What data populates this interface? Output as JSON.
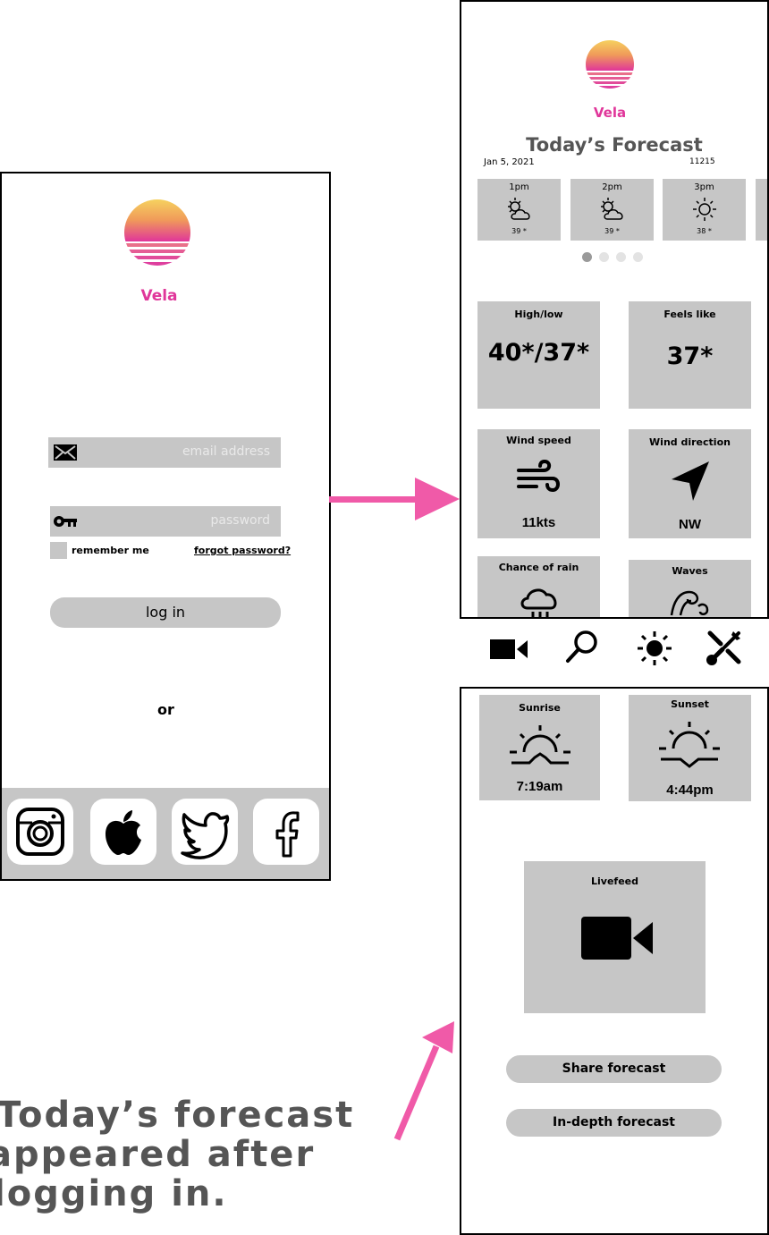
{
  "brand": {
    "name": "Vela",
    "color": "#e0369a"
  },
  "login": {
    "email_placeholder": "email address",
    "password_placeholder": "password",
    "remember_label": "remember me",
    "forgot_label": "forgot password?",
    "login_label": "log in",
    "or_label": "or",
    "social_icons": [
      "instagram-icon",
      "apple-icon",
      "twitter-icon",
      "facebook-icon"
    ]
  },
  "forecast": {
    "title": "Today’s Forecast",
    "date": "Jan 5, 2021",
    "zip": "11215",
    "hours": [
      {
        "time": "1pm",
        "temp": "39 *",
        "icon": "partly-cloudy-icon"
      },
      {
        "time": "2pm",
        "temp": "39 *",
        "icon": "partly-cloudy-icon"
      },
      {
        "time": "3pm",
        "temp": "38 *",
        "icon": "sun-icon"
      }
    ],
    "carousel_active": 1,
    "carousel_count": 4,
    "high_low": {
      "label": "High/low",
      "value": "40*/37*"
    },
    "feels_like": {
      "label": "Feels like",
      "value": "37*"
    },
    "wind_speed": {
      "label": "Wind speed",
      "value": "11kts"
    },
    "wind_direction": {
      "label": "Wind direction",
      "value": "NW"
    },
    "chance_of_rain": {
      "label": "Chance of rain"
    },
    "waves": {
      "label": "Waves"
    },
    "nav_icons": [
      "video-camera-icon",
      "search-icon",
      "sun-icon",
      "tools-icon"
    ],
    "sunrise": {
      "label": "Sunrise",
      "value": "7:19am"
    },
    "sunset": {
      "label": "Sunset",
      "value": "4:44pm"
    },
    "livefeed": {
      "label": "Livefeed"
    },
    "share_label": "Share forecast",
    "indepth_label": "In-depth forecast"
  },
  "caption": {
    "line1": "Today’s forecast",
    "line2": "appeared after",
    "line3": "logging in."
  },
  "colors": {
    "arrow": "#f05aa8",
    "tile": "#c6c6c6",
    "caption": "#555555"
  }
}
